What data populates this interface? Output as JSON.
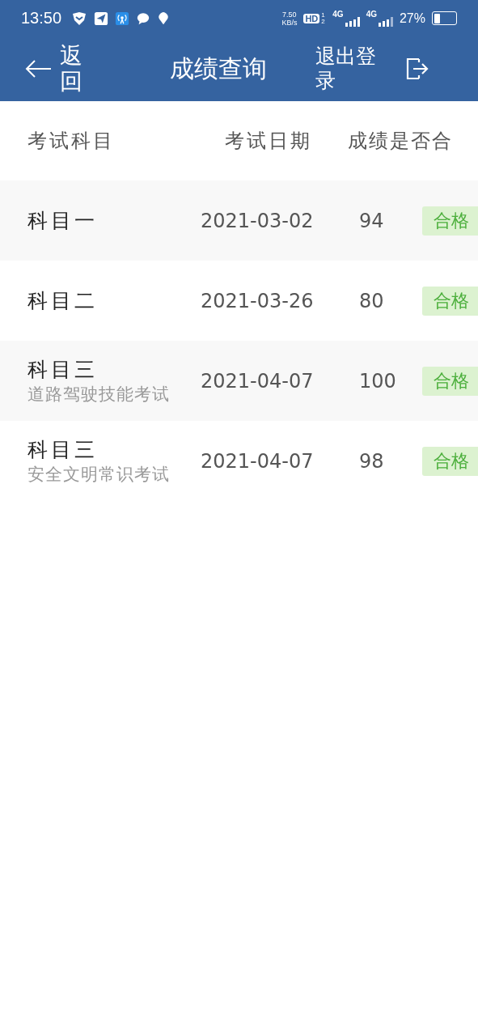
{
  "status_bar": {
    "time": "13:50",
    "speed": "7.50",
    "speed_unit": "KB/s",
    "hd": "HD",
    "sims": "1 2",
    "network_1": "4G",
    "network_2": "4G",
    "battery": "27%"
  },
  "nav": {
    "back": "返回",
    "title": "成绩查询",
    "logout": "退出登录"
  },
  "table": {
    "columns": [
      "考试科目",
      "考试日期",
      "成绩是否合"
    ],
    "rows": [
      {
        "subject": "科目一",
        "date": "2021-03-02",
        "score": "94",
        "result": "合格"
      },
      {
        "subject": "科目二",
        "date": "2021-03-26",
        "score": "80",
        "result": "合格"
      },
      {
        "subject": "科目三",
        "detail": "道路驾驶技能考试",
        "date": "2021-04-07",
        "score": "100",
        "result": "合格"
      },
      {
        "subject": "科目三",
        "detail": "安全文明常识考试",
        "date": "2021-04-07",
        "score": "98",
        "result": "合格"
      }
    ]
  }
}
